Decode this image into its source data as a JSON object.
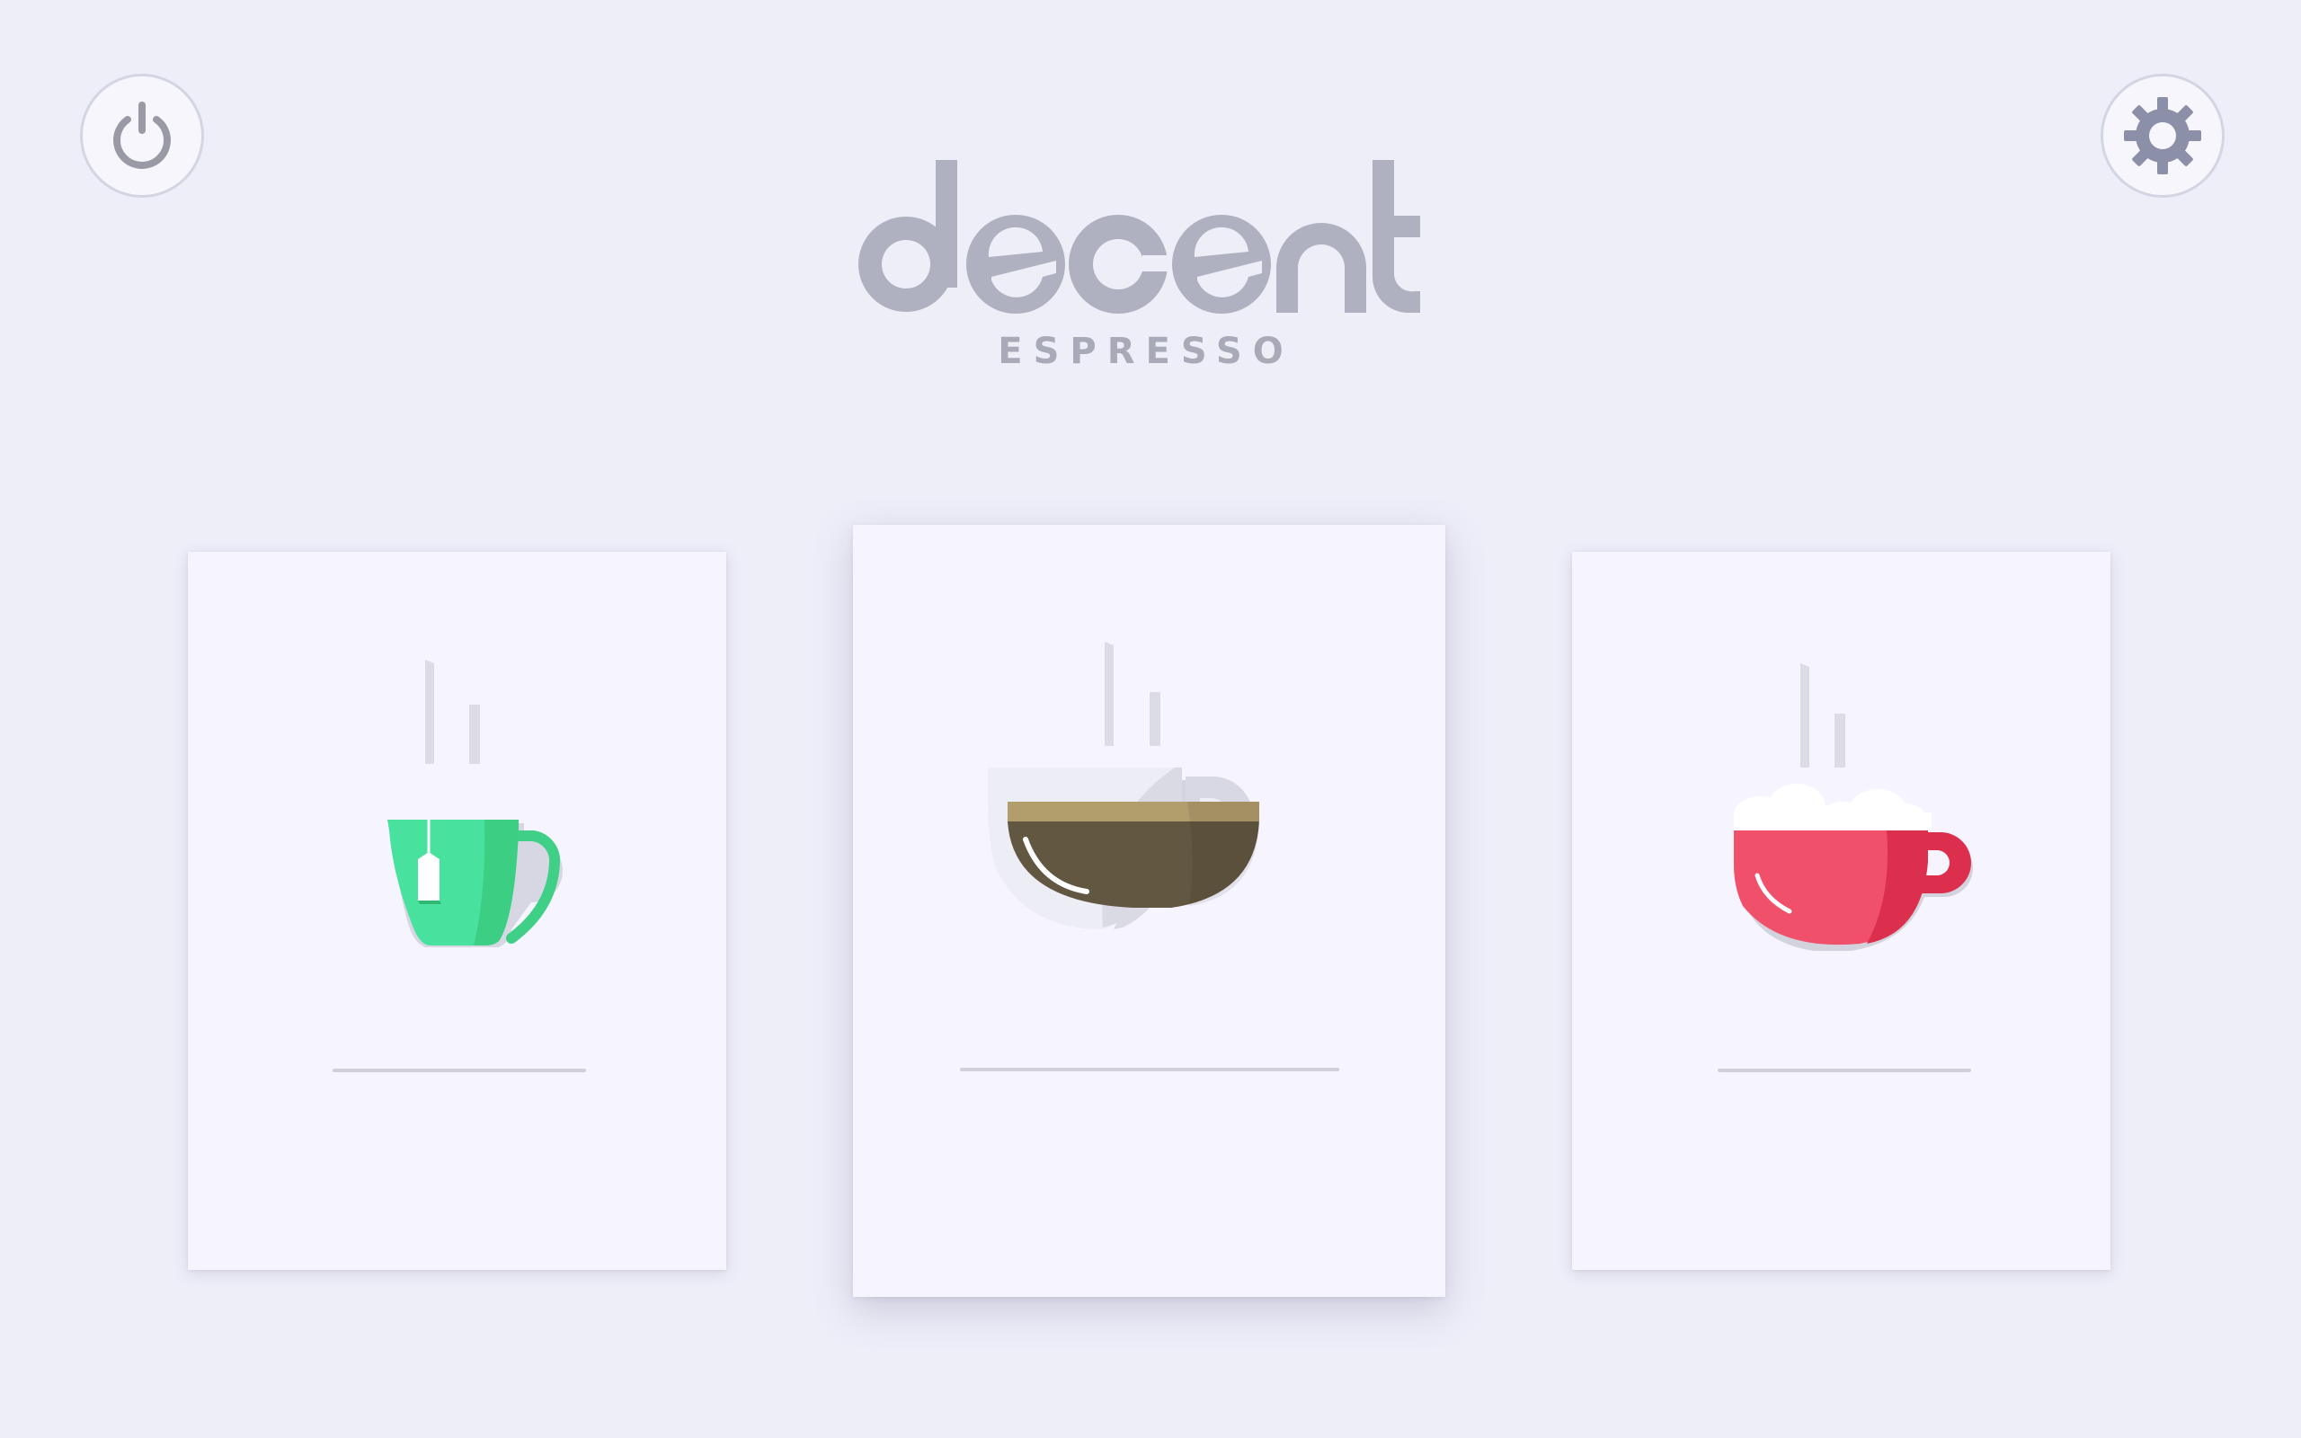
{
  "app": {
    "brand_name": "decent",
    "brand_sub": "ESPRESSO"
  },
  "controls": {
    "power_icon": "power-icon",
    "settings_icon": "gear-icon"
  },
  "cards": [
    {
      "id": "tea",
      "icon": "tea-mug-icon",
      "label": "",
      "accent": "#46e09d"
    },
    {
      "id": "espresso",
      "icon": "espresso-cup-icon",
      "label": "",
      "accent": "#625741"
    },
    {
      "id": "cappuccino",
      "icon": "cappuccino-cup-icon",
      "label": "",
      "accent": "#f0506a"
    }
  ],
  "colors": {
    "background": "#eeeef9",
    "card": "#f6f5ff",
    "logo": "#b0b1c0",
    "steam": "#dcdce6"
  }
}
